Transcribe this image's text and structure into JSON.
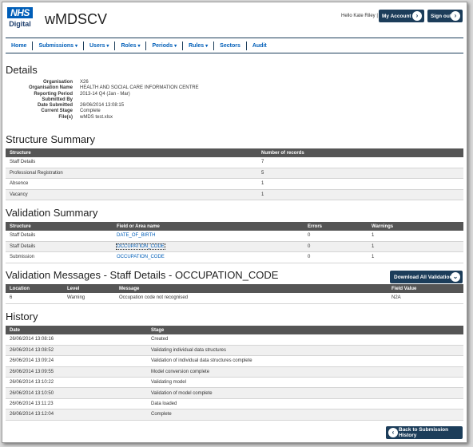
{
  "header": {
    "logo_text": "NHS",
    "logo_sub": "Digital",
    "app_title": "wMDSCV",
    "greeting": "Hello Kate Riley |",
    "my_account_label": "My Account",
    "sign_out_label": "Sign out"
  },
  "nav": [
    {
      "label": "Home",
      "caret": ""
    },
    {
      "label": "Submissions",
      "caret": "▾"
    },
    {
      "label": "Users",
      "caret": "▾"
    },
    {
      "label": "Roles",
      "caret": "▾"
    },
    {
      "label": "Periods",
      "caret": "▾"
    },
    {
      "label": "Rules",
      "caret": "▾"
    },
    {
      "label": "Sectors",
      "caret": ""
    },
    {
      "label": "Audit",
      "caret": ""
    }
  ],
  "details": {
    "heading": "Details",
    "rows": [
      {
        "label": "Organisation",
        "value": "X26"
      },
      {
        "label": "Organisation Name",
        "value": "HEALTH AND SOCIAL CARE INFORMATION CENTRE"
      },
      {
        "label": "Reporting Period",
        "value": "2013-14 Q4 (Jan - Mar)"
      },
      {
        "label": "Submitted By",
        "value": ""
      },
      {
        "label": "Date Submitted",
        "value": "26/06/2014 13:08:15"
      },
      {
        "label": "Current Stage",
        "value": "Complete"
      },
      {
        "label": "File(s)",
        "value": "wMDS test.xlsx"
      }
    ]
  },
  "structure_summary": {
    "heading": "Structure Summary",
    "columns": [
      "Structure",
      "Number of records"
    ],
    "rows": [
      [
        "Staff Details",
        "7"
      ],
      [
        "Professional Registration",
        "5"
      ],
      [
        "Absence",
        "1"
      ],
      [
        "Vacancy",
        "1"
      ]
    ]
  },
  "validation_summary": {
    "heading": "Validation Summary",
    "columns": [
      "Structure",
      "Field or Area name",
      "Errors",
      "Warnings"
    ],
    "rows": [
      [
        "Staff Details",
        "DATE_OF_BIRTH",
        "0",
        "1"
      ],
      [
        "Staff Details",
        "OCCUPATION_CODE",
        "0",
        "1"
      ],
      [
        "Submission",
        "OCCUPATION_CODE",
        "0",
        "1"
      ]
    ]
  },
  "validation_messages": {
    "heading": "Validation Messages - Staff Details - OCCUPATION_CODE",
    "download_label": "Download All Validations",
    "columns": [
      "Location",
      "Level",
      "Message",
      "Field Value"
    ],
    "rows": [
      [
        "6",
        "Warning",
        "Occupation code not recognised",
        "N2A"
      ]
    ]
  },
  "history": {
    "heading": "History",
    "columns": [
      "Date",
      "Stage"
    ],
    "rows": [
      [
        "26/06/2014 13:08:16",
        "Created"
      ],
      [
        "26/06/2014 13:08:52",
        "Validating individual data structures"
      ],
      [
        "26/06/2014 13:09:24",
        "Validation of individual data structures complete"
      ],
      [
        "26/06/2014 13:09:55",
        "Model conversion complete"
      ],
      [
        "26/06/2014 13:10:22",
        "Validating model"
      ],
      [
        "26/06/2014 13:10:50",
        "Validation of model complete"
      ],
      [
        "26/06/2014 13:11:23",
        "Data loaded"
      ],
      [
        "26/06/2014 13:12:04",
        "Complete"
      ]
    ]
  },
  "back_label": "Back to Submission History",
  "colors": {
    "nav_blue": "#005eb8",
    "button_dark": "#1c3d5a",
    "table_header": "#555555"
  }
}
